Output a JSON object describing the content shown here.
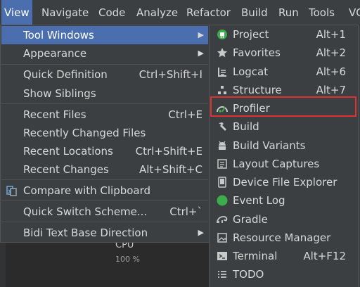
{
  "menubar": {
    "items": [
      {
        "label": "View"
      },
      {
        "label": "Navigate"
      },
      {
        "label": "Code"
      },
      {
        "label": "Analyze"
      },
      {
        "label": "Refactor"
      },
      {
        "label": "Build"
      },
      {
        "label": "Run"
      },
      {
        "label": "Tools"
      },
      {
        "label": "VC"
      }
    ]
  },
  "view_menu": {
    "items": [
      {
        "label": "Tool Windows",
        "shortcut": "",
        "submenu_arrow": "▶"
      },
      {
        "label": "Appearance",
        "shortcut": "",
        "submenu_arrow": "▶"
      },
      {
        "label": "Quick Definition",
        "shortcut": "Ctrl+Shift+I"
      },
      {
        "label": "Show Siblings",
        "shortcut": ""
      },
      {
        "label": "Recent Files",
        "shortcut": "Ctrl+E"
      },
      {
        "label": "Recently Changed Files",
        "shortcut": ""
      },
      {
        "label": "Recent Locations",
        "shortcut": "Ctrl+Shift+E"
      },
      {
        "label": "Recent Changes",
        "shortcut": "Alt+Shift+C"
      },
      {
        "label": "Compare with Clipboard",
        "shortcut": ""
      },
      {
        "label": "Quick Switch Scheme...",
        "shortcut": "Ctrl+`"
      },
      {
        "label": "Bidi Text Base Direction",
        "shortcut": "",
        "submenu_arrow": "▶"
      }
    ]
  },
  "tool_windows_menu": {
    "items": [
      {
        "label": "Project",
        "shortcut": "Alt+1",
        "icon": "project-icon"
      },
      {
        "label": "Favorites",
        "shortcut": "Alt+2",
        "icon": "star-icon"
      },
      {
        "label": "Logcat",
        "shortcut": "Alt+6",
        "icon": "logcat-icon"
      },
      {
        "label": "Structure",
        "shortcut": "Alt+7",
        "icon": "structure-icon"
      },
      {
        "label": "Profiler",
        "shortcut": "",
        "icon": "profiler-icon"
      },
      {
        "label": "Build",
        "shortcut": "",
        "icon": "hammer-icon"
      },
      {
        "label": "Build Variants",
        "shortcut": "",
        "icon": "android-icon"
      },
      {
        "label": "Layout Captures",
        "shortcut": "",
        "icon": "layout-captures-icon"
      },
      {
        "label": "Device File Explorer",
        "shortcut": "",
        "icon": "device-icon"
      },
      {
        "label": "Event Log",
        "shortcut": "",
        "icon": "event-log-icon"
      },
      {
        "label": "Gradle",
        "shortcut": "",
        "icon": "gradle-icon"
      },
      {
        "label": "Resource Manager",
        "shortcut": "",
        "icon": "resource-manager-icon"
      },
      {
        "label": "Terminal",
        "shortcut": "Alt+F12",
        "icon": "terminal-icon"
      },
      {
        "label": "TODO",
        "shortcut": "",
        "icon": "todo-icon"
      }
    ]
  },
  "background": {
    "cpu_label": "CPU",
    "cpu_percent": "100 %"
  },
  "colors": {
    "accent": "#4b6eaf",
    "highlight_border": "#e03030",
    "event_log_green": "#3dac4a"
  }
}
